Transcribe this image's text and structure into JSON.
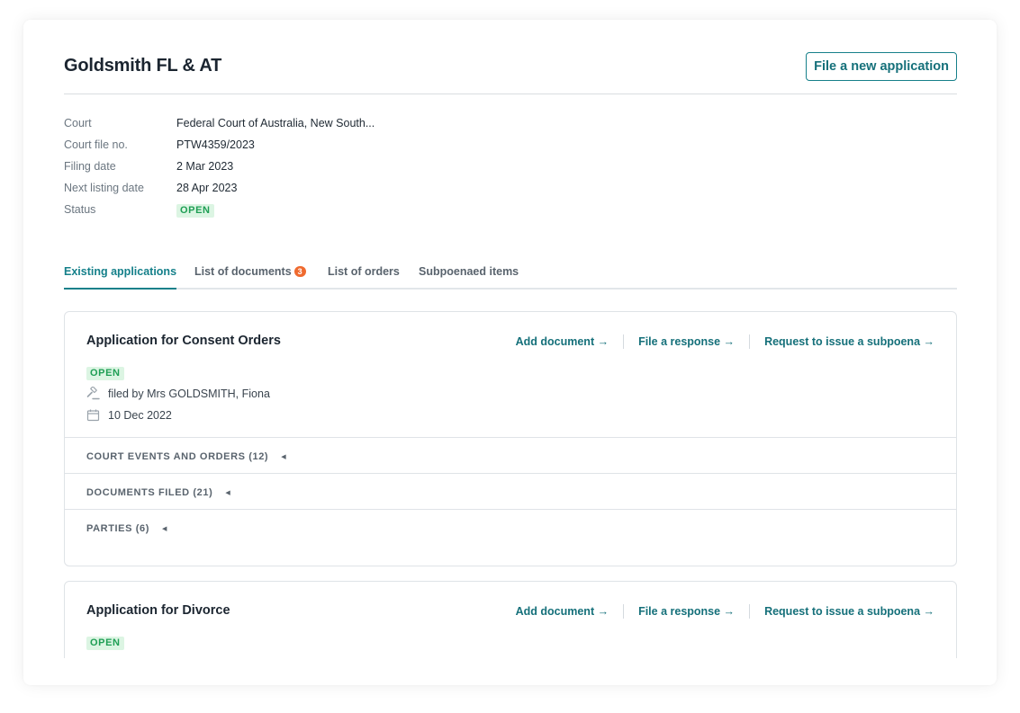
{
  "case": {
    "title": "Goldsmith FL & AT",
    "new_application_label": "File a new application"
  },
  "details": [
    {
      "label": "Court",
      "value": "Federal Court of Australia, New South..."
    },
    {
      "label": "Court file no.",
      "value": "PTW4359/2023"
    },
    {
      "label": "Filing date",
      "value": "2 Mar 2023"
    },
    {
      "label": "Next listing date",
      "value": "28 Apr 2023"
    },
    {
      "label": "Status",
      "value": "OPEN"
    }
  ],
  "tabs": [
    {
      "label": "Existing applications",
      "active": true
    },
    {
      "label": "List of documents",
      "count": "3"
    },
    {
      "label": "List of orders"
    },
    {
      "label": "Subpoenaed items"
    }
  ],
  "actions": {
    "add_document": "Add document →",
    "file_response": "File a response →",
    "request_subpoena": "Request to issue a subpoena →"
  },
  "applications": [
    {
      "title": "Application for Consent Orders",
      "status": "OPEN",
      "filed_by": "filed by Mrs GOLDSMITH, Fiona",
      "date": "10 Dec 2022",
      "sections": [
        "COURT EVENTS AND ORDERS (12)",
        "DOCUMENTS FILED (21)",
        "PARTIES (6)"
      ]
    },
    {
      "title": "Application for Divorce",
      "status": "OPEN"
    }
  ],
  "colors": {
    "accent": "#15808a",
    "status_open_bg": "#dcf5e3",
    "status_open_text": "#1e9e54",
    "count_badge": "#ef6a2f"
  }
}
